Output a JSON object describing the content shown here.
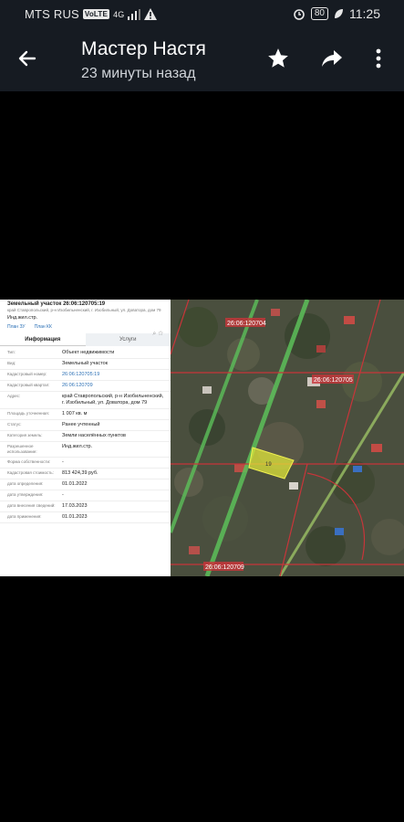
{
  "status": {
    "carrier": "MTS RUS",
    "volte": "VoLTE",
    "network": "4G",
    "battery": "80",
    "time": "11:25"
  },
  "header": {
    "title": "Мастер Настя",
    "subtitle": "23 минуты назад"
  },
  "parcel": {
    "heading": "Земельный участок 26:06:120705:19",
    "address_line": "край Ставропольский, р-н Изобильненский, г. Изобильный, ул. Доватора, дом 79",
    "use_short": "Инд.жил.стр.",
    "plan_zu": "План ЗУ",
    "plan_kk": "План КК",
    "tab_info": "Информация",
    "tab_services": "Услуги",
    "rows": [
      {
        "label": "Тип:",
        "value": "Объект недвижимости",
        "link": false
      },
      {
        "label": "Вид:",
        "value": "Земельный участок",
        "link": false
      },
      {
        "label": "Кадастровый номер:",
        "value": "26:06:120705:19",
        "link": true
      },
      {
        "label": "Кадастровый квартал:",
        "value": "26:06:120709",
        "link": true
      },
      {
        "label": "Адрес:",
        "value": "край Ставропольский, р-н Изобильненский, г. Изобильный, ул. Доватора, дом 79",
        "link": false
      },
      {
        "label": "Площадь уточненная:",
        "value": "1 007 кв. м",
        "link": false
      },
      {
        "label": "Статус:",
        "value": "Ранее учтенный",
        "link": false
      },
      {
        "label": "Категория земель:",
        "value": "Земли населённых пунктов",
        "link": false
      },
      {
        "label": "Разрешенное использование:",
        "value": "Инд.жил.стр.",
        "link": false
      },
      {
        "label": "Форма собственности:",
        "value": "-",
        "link": false
      },
      {
        "label": "Кадастровая стоимость:",
        "value": "813 424,39 руб.",
        "link": false
      },
      {
        "label": "дата определения:",
        "value": "01.01.2022",
        "link": false
      },
      {
        "label": "дата утверждения:",
        "value": "-",
        "link": false
      },
      {
        "label": "дата внесения сведений:",
        "value": "17.03.2023",
        "link": false
      },
      {
        "label": "дата применения:",
        "value": "01.01.2023",
        "link": false
      }
    ]
  },
  "map": {
    "labels": [
      "26:06:120704",
      "26:06:120705",
      "26:06:120709",
      "19"
    ]
  }
}
